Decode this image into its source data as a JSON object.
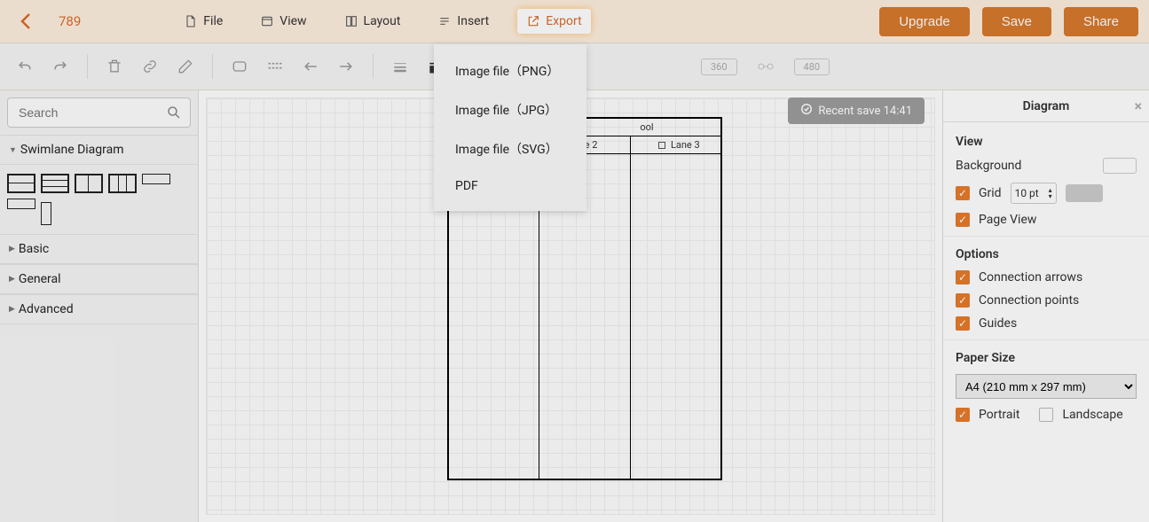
{
  "doc_title": "789",
  "menu": {
    "file": "File",
    "view": "View",
    "layout": "Layout",
    "insert": "Insert",
    "export": "Export"
  },
  "buttons": {
    "upgrade": "Upgrade",
    "save": "Save",
    "share": "Share"
  },
  "toolbar": {
    "dim1": "360",
    "dim2": "480"
  },
  "search_placeholder": "Search",
  "palette": {
    "section_swimlane": "Swimlane Diagram",
    "section_basic": "Basic",
    "section_general": "General",
    "section_advanced": "Advanced"
  },
  "save_toast": "Recent save 14:41",
  "swimlane": {
    "pool": "ool",
    "lane2": "ne 2",
    "lane3": "Lane 3"
  },
  "export_menu": {
    "png": "Image file（PNG）",
    "jpg": "Image file（JPG）",
    "svg": "Image file（SVG）",
    "pdf": "PDF"
  },
  "panel": {
    "title": "Diagram",
    "view_title": "View",
    "background": "Background",
    "grid": "Grid",
    "grid_value": "10 pt",
    "page_view": "Page View",
    "options_title": "Options",
    "conn_arrows": "Connection arrows",
    "conn_points": "Connection points",
    "guides": "Guides",
    "paper_title": "Paper Size",
    "paper_value": "A4 (210 mm x 297 mm)",
    "portrait": "Portrait",
    "landscape": "Landscape"
  }
}
